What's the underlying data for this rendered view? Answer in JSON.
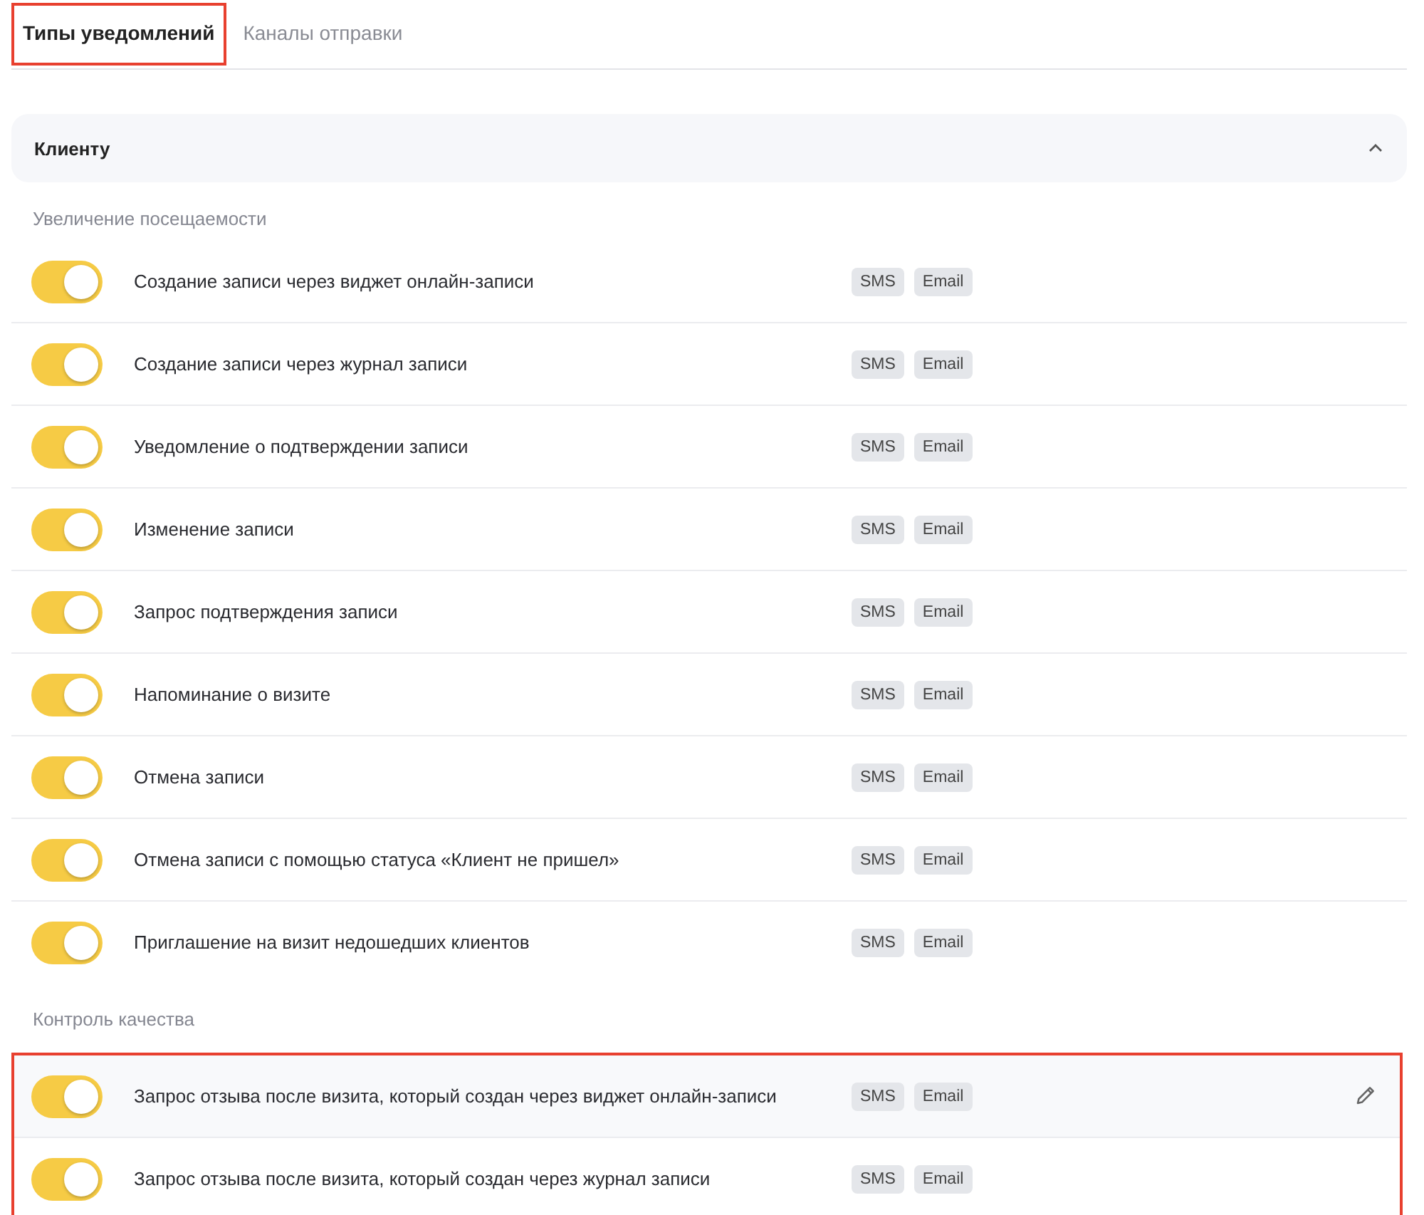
{
  "tabs": [
    {
      "label": "Типы уведомлений",
      "selected": true,
      "highlighted": true
    },
    {
      "label": "Каналы отправки",
      "selected": false,
      "highlighted": false
    }
  ],
  "panel": {
    "title": "Клиенту",
    "expanded": true
  },
  "sections": [
    {
      "title": "Увеличение посещаемости",
      "highlighted": false,
      "rows": [
        {
          "on": true,
          "label": "Создание записи через виджет онлайн-записи",
          "channels": [
            "SMS",
            "Email"
          ],
          "hovered": false
        },
        {
          "on": true,
          "label": "Создание записи через журнал записи",
          "channels": [
            "SMS",
            "Email"
          ],
          "hovered": false
        },
        {
          "on": true,
          "label": "Уведомление о подтверждении записи",
          "channels": [
            "SMS",
            "Email"
          ],
          "hovered": false
        },
        {
          "on": true,
          "label": "Изменение записи",
          "channels": [
            "SMS",
            "Email"
          ],
          "hovered": false
        },
        {
          "on": true,
          "label": "Запрос подтверждения записи",
          "channels": [
            "SMS",
            "Email"
          ],
          "hovered": false
        },
        {
          "on": true,
          "label": "Напоминание о визите",
          "channels": [
            "SMS",
            "Email"
          ],
          "hovered": false
        },
        {
          "on": true,
          "label": "Отмена записи",
          "channels": [
            "SMS",
            "Email"
          ],
          "hovered": false
        },
        {
          "on": true,
          "label": "Отмена записи с помощью статуса «Клиент не пришел»",
          "channels": [
            "SMS",
            "Email"
          ],
          "hovered": false
        },
        {
          "on": true,
          "label": "Приглашение на визит недошедших клиентов",
          "channels": [
            "SMS",
            "Email"
          ],
          "hovered": false
        }
      ]
    },
    {
      "title": "Контроль качества",
      "highlighted": true,
      "rows": [
        {
          "on": true,
          "label": "Запрос отзыва после визита, который создан через виджет онлайн-записи",
          "channels": [
            "SMS",
            "Email"
          ],
          "hovered": true
        },
        {
          "on": true,
          "label": "Запрос отзыва после визита, который создан через журнал записи",
          "channels": [
            "SMS",
            "Email"
          ],
          "hovered": false
        }
      ]
    }
  ]
}
